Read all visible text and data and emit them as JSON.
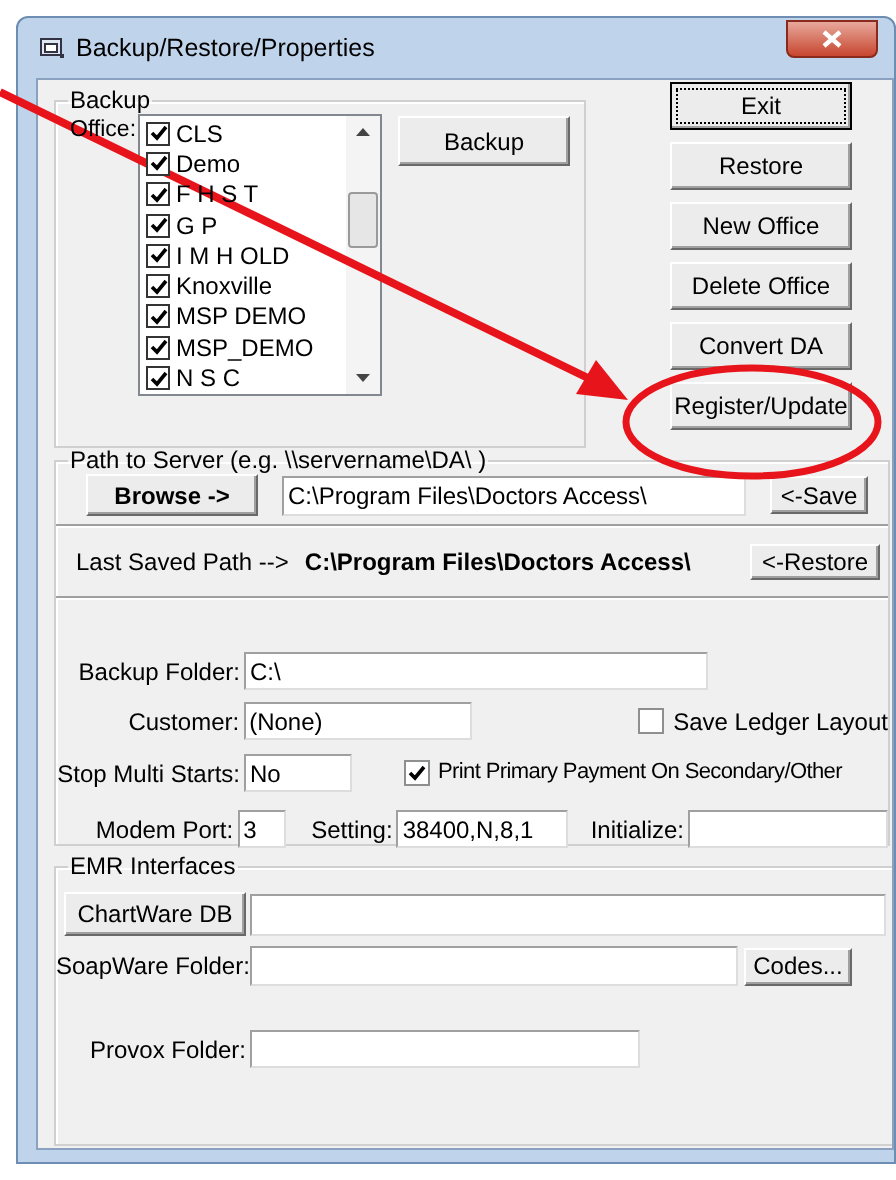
{
  "window": {
    "title": "Backup/Restore/Properties"
  },
  "backup_group": {
    "legend": "Backup",
    "office_label": "Office:",
    "backup_button": "Backup",
    "offices": [
      {
        "label": "CLS",
        "checked": true
      },
      {
        "label": "Demo",
        "checked": true
      },
      {
        "label": "F H S T",
        "checked": true
      },
      {
        "label": "G P",
        "checked": true
      },
      {
        "label": "I M H OLD",
        "checked": true
      },
      {
        "label": "Knoxville",
        "checked": true
      },
      {
        "label": "MSP DEMO",
        "checked": true
      },
      {
        "label": "MSP_DEMO",
        "checked": true
      },
      {
        "label": "N S C",
        "checked": true
      }
    ]
  },
  "side_buttons": [
    {
      "label": "Exit",
      "focused": true
    },
    {
      "label": "Restore",
      "focused": false
    },
    {
      "label": "New Office",
      "focused": false
    },
    {
      "label": "Delete Office",
      "focused": false
    },
    {
      "label": "Convert DA",
      "focused": false
    },
    {
      "label": "Register/Update",
      "focused": false
    }
  ],
  "path_group": {
    "legend": "Path to Server (e.g. \\\\servername\\DA\\ )",
    "browse_button": "Browse ->",
    "path_value": "C:\\Program Files\\Doctors Access\\",
    "save_button": "<-Save",
    "last_saved_label": "Last Saved Path -->",
    "last_saved_path": "C:\\Program Files\\Doctors Access\\",
    "restore_button": "<-Restore"
  },
  "settings": {
    "backup_folder": {
      "label": "Backup Folder:",
      "value": "C:\\"
    },
    "customer": {
      "label": "Customer:",
      "value": "(None)"
    },
    "save_ledger_layout": {
      "label": "Save Ledger Layout",
      "checked": false
    },
    "stop_multi_starts": {
      "label": "Stop Multi Starts:",
      "value": "No"
    },
    "print_primary": {
      "label": "Print Primary Payment On Secondary/Other",
      "checked": true
    },
    "modem_port": {
      "label": "Modem Port:",
      "value": "3"
    },
    "setting": {
      "label": "Setting:",
      "value": "38400,N,8,1"
    },
    "initialize": {
      "label": "Initialize:"
    }
  },
  "emr_group": {
    "legend": "EMR Interfaces",
    "chartware_button": "ChartWare DB",
    "soapware_label": "SoapWare Folder:",
    "codes_button": "Codes...",
    "provox_label": "Provox Folder:"
  }
}
